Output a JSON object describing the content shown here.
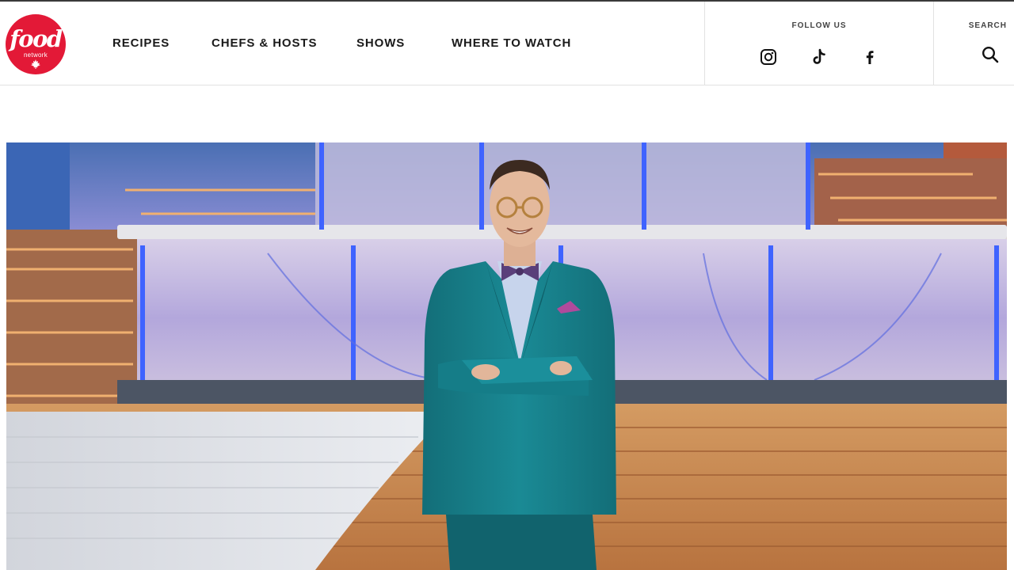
{
  "brand": {
    "logo_text": "food",
    "logo_subtext": "network",
    "color": "#e31937"
  },
  "nav": {
    "items": [
      {
        "label": "RECIPES"
      },
      {
        "label": "CHEFS & HOSTS"
      },
      {
        "label": "SHOWS"
      },
      {
        "label": "WHERE TO WATCH"
      }
    ]
  },
  "follow": {
    "label": "FOLLOW US",
    "icons": [
      "instagram-icon",
      "tiktok-icon",
      "facebook-icon"
    ]
  },
  "search": {
    "label": "SEARCH",
    "icon": "search-icon"
  },
  "hero": {
    "image": "host-on-studio-set",
    "colors": {
      "suit": "#17808a",
      "floor": "#c9874c",
      "backdrop_glow": "#6f7fd8"
    }
  }
}
